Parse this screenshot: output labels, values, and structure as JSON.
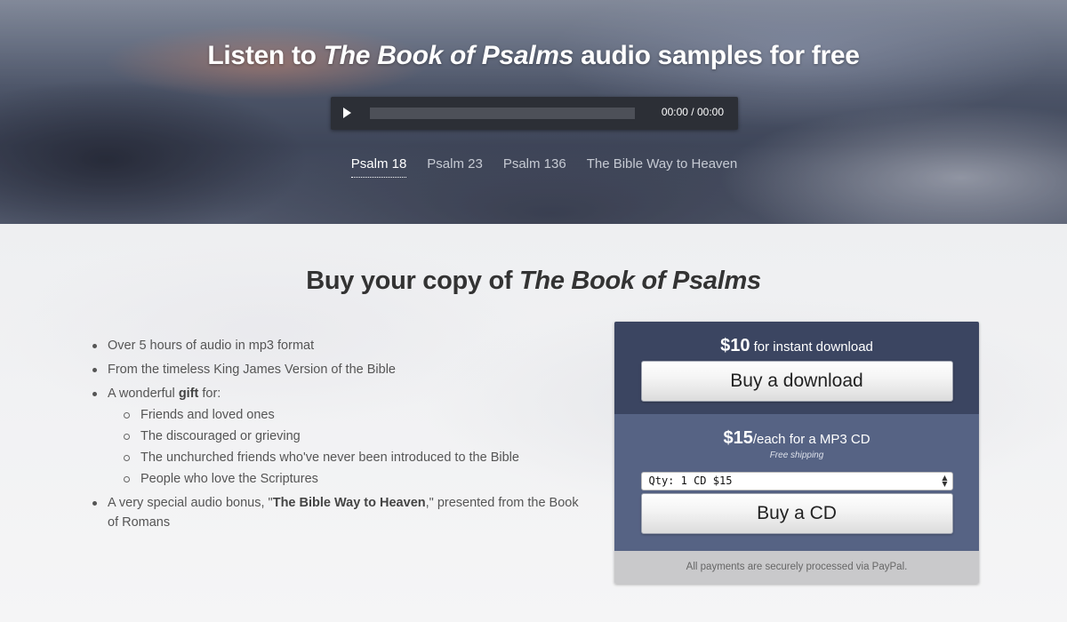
{
  "hero": {
    "title_prefix": "Listen to ",
    "title_book": "The Book of Psalms",
    "title_middle": " audio samples for ",
    "title_strong": "free",
    "player": {
      "time_current": "00:00",
      "time_separator": " / ",
      "time_total": "00:00",
      "progress": 0
    },
    "tracks": [
      {
        "label": "Psalm 18",
        "active": true
      },
      {
        "label": "Psalm 23",
        "active": false
      },
      {
        "label": "Psalm 136",
        "active": false
      },
      {
        "label": "The Bible Way to Heaven",
        "active": false
      }
    ]
  },
  "main": {
    "title_strong": "Buy",
    "title_middle": " your copy of ",
    "title_book": "The Book of Psalms",
    "features": {
      "item1": "Over 5 hours of audio in mp3 format",
      "item2": "From the timeless King James Version of the Bible",
      "item3_prefix": "A wonderful ",
      "item3_strong": "gift",
      "item3_suffix": " for:",
      "sub_items": [
        "Friends and loved ones",
        "The discouraged or grieving",
        "The unchurched friends who've never been introduced to the Bible",
        "People who love the Scriptures"
      ],
      "item4_prefix": "A very special audio bonus, \"",
      "item4_strong": "The Bible Way to Heaven",
      "item4_suffix": ",\" presented from the Book of Romans"
    }
  },
  "purchase": {
    "download": {
      "price": "$10",
      "price_text": " for instant download",
      "button_label": "Buy a download"
    },
    "cd": {
      "price": "$15",
      "price_text": "/each for a MP3 CD",
      "shipping": "Free shipping",
      "qty_selected": "Qty: 1 CD $15",
      "button_label": "Buy a CD"
    },
    "footer_note": "All payments are securely processed via PayPal."
  },
  "colors": {
    "panel_top": "#3b4561",
    "panel_mid": "#566384",
    "panel_footer": "#c9c9cb"
  }
}
